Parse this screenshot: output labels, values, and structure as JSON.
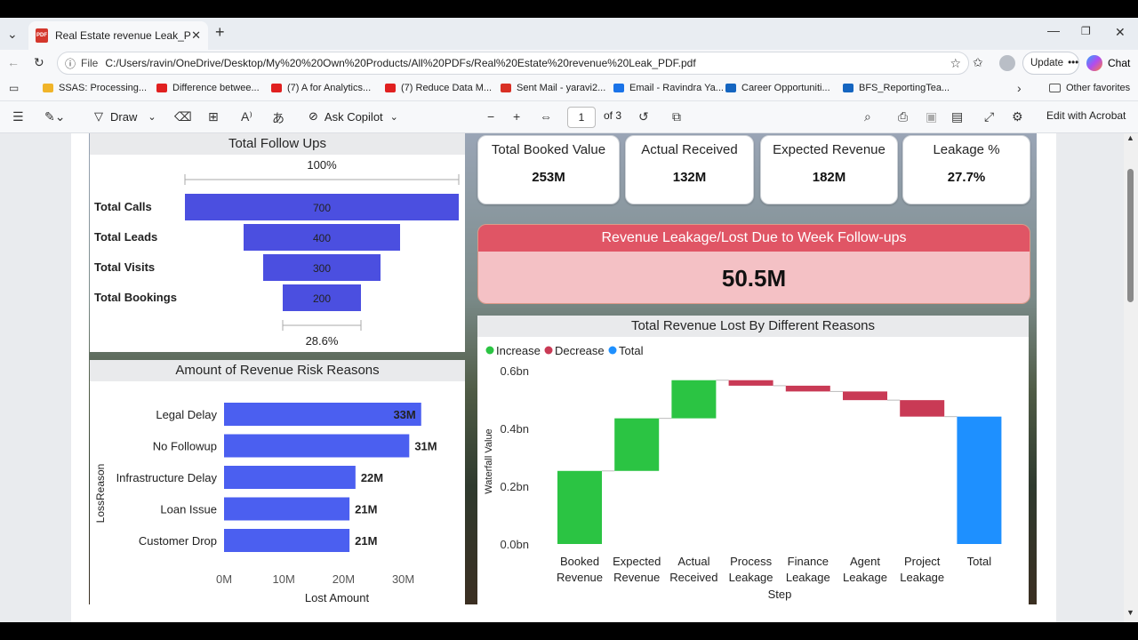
{
  "browser": {
    "tab_title": "Real Estate revenue Leak_PDF.pdf",
    "pdf_badge": "PDF",
    "url_label": "File",
    "url": "C:/Users/ravin/OneDrive/Desktop/My%20%20Own%20Products/All%20PDFs/Real%20Estate%20revenue%20Leak_PDF.pdf",
    "update_label": "Update",
    "chat_label": "Chat"
  },
  "favorites": [
    {
      "label": "SSAS: Processing...",
      "color": "#f0b429"
    },
    {
      "label": "Difference betwee...",
      "color": "#e02020"
    },
    {
      "label": "(7) A for Analytics...",
      "color": "#e02020"
    },
    {
      "label": "(7) Reduce Data M...",
      "color": "#e02020"
    },
    {
      "label": "Sent Mail - yaravi2...",
      "color": "#d93025"
    },
    {
      "label": "Email - Ravindra Ya...",
      "color": "#1a73e8"
    },
    {
      "label": "Career Opportuniti...",
      "color": "#1565c0"
    },
    {
      "label": "BFS_ReportingTea...",
      "color": "#1565c0"
    }
  ],
  "favorites_other": "Other favorites",
  "pdf_toolbar": {
    "draw_label": "Draw",
    "copilot_label": "Ask Copilot",
    "page_number": "1",
    "page_total": "of 3",
    "acrobat_label": "Edit with Acrobat"
  },
  "dashboard": {
    "funnel": {
      "title": "Total Follow Ups",
      "top_pct": "100%",
      "bottom_pct": "28.6%",
      "stages": [
        {
          "label": "Total Calls",
          "value": 700
        },
        {
          "label": "Total Leads",
          "value": 400
        },
        {
          "label": "Total Visits",
          "value": 300
        },
        {
          "label": "Total Bookings",
          "value": 200
        }
      ],
      "color": "#4b4fe0"
    },
    "kpis": [
      {
        "title": "Total Booked Value",
        "value": "253M"
      },
      {
        "title": "Actual Received",
        "value": "132M"
      },
      {
        "title": "Expected Revenue",
        "value": "182M"
      },
      {
        "title": "Leakage %",
        "value": "27.7%"
      }
    ],
    "leakage_card": {
      "title": "Revenue Leakage/Lost Due to Week Follow-ups",
      "value": "50.5M",
      "head_color": "#e05565",
      "body_color": "#f4c1c5"
    },
    "risk_reasons": {
      "title": "Amount of Revenue Risk Reasons",
      "xlabel": "Lost Amount",
      "ylabel": "LossReason",
      "xticks": [
        "0M",
        "10M",
        "20M",
        "30M"
      ],
      "xlim": [
        0,
        35
      ],
      "bars": [
        {
          "label": "Legal Delay",
          "value": 33,
          "text": "33M"
        },
        {
          "label": "No Followup",
          "value": 31,
          "text": "31M"
        },
        {
          "label": "Infrastructure Delay",
          "value": 22,
          "text": "22M"
        },
        {
          "label": "Loan Issue",
          "value": 21,
          "text": "21M"
        },
        {
          "label": "Customer Drop",
          "value": 21,
          "text": "21M"
        }
      ],
      "color": "#4b5ff0"
    },
    "waterfall": {
      "title": "Total Revenue Lost By Different Reasons",
      "legend": [
        {
          "label": "Increase",
          "color": "#2bc443"
        },
        {
          "label": "Decrease",
          "color": "#c93a55"
        },
        {
          "label": "Total",
          "color": "#1e90ff"
        }
      ],
      "ylabel": "Waterfall Value",
      "xlabel": "Step",
      "yticks": [
        "0.0bn",
        "0.2bn",
        "0.4bn",
        "0.6bn"
      ]
    }
  },
  "chart_data": [
    {
      "type": "bar",
      "title": "Total Follow Ups",
      "categories": [
        "Total Calls",
        "Total Leads",
        "Total Visits",
        "Total Bookings"
      ],
      "values": [
        700,
        400,
        300,
        200
      ]
    },
    {
      "type": "bar",
      "title": "Amount of Revenue Risk Reasons",
      "categories": [
        "Legal Delay",
        "No Followup",
        "Infrastructure Delay",
        "Loan Issue",
        "Customer Drop"
      ],
      "values": [
        33,
        31,
        22,
        21,
        21
      ],
      "xlabel": "Lost Amount",
      "ylabel": "LossReason",
      "xlim": [
        0,
        35
      ]
    },
    {
      "type": "bar",
      "title": "Total Revenue Lost By Different Reasons",
      "categories": [
        "Booked Revenue",
        "Expected Revenue",
        "Actual Received",
        "Process Leakage",
        "Finance Leakage",
        "Agent Leakage",
        "Project Leakage",
        "Total"
      ],
      "category_lines": [
        [
          "Booked",
          "Revenue"
        ],
        [
          "Expected",
          "Revenue"
        ],
        [
          "Actual",
          "Received"
        ],
        [
          "Process",
          "Leakage"
        ],
        [
          "Finance",
          "Leakage"
        ],
        [
          "Agent",
          "Leakage"
        ],
        [
          "Project",
          "Leakage"
        ],
        [
          "Total"
        ]
      ],
      "steps": [
        {
          "start": 0.0,
          "end": 0.253,
          "kind": "increase"
        },
        {
          "start": 0.253,
          "end": 0.435,
          "kind": "increase"
        },
        {
          "start": 0.435,
          "end": 0.567,
          "kind": "increase"
        },
        {
          "start": 0.567,
          "end": 0.548,
          "kind": "decrease"
        },
        {
          "start": 0.548,
          "end": 0.528,
          "kind": "decrease"
        },
        {
          "start": 0.528,
          "end": 0.498,
          "kind": "decrease"
        },
        {
          "start": 0.498,
          "end": 0.441,
          "kind": "decrease"
        },
        {
          "start": 0.0,
          "end": 0.441,
          "kind": "total"
        }
      ],
      "xlabel": "Step",
      "ylabel": "Waterfall Value",
      "ylim": [
        0,
        0.6
      ]
    }
  ]
}
